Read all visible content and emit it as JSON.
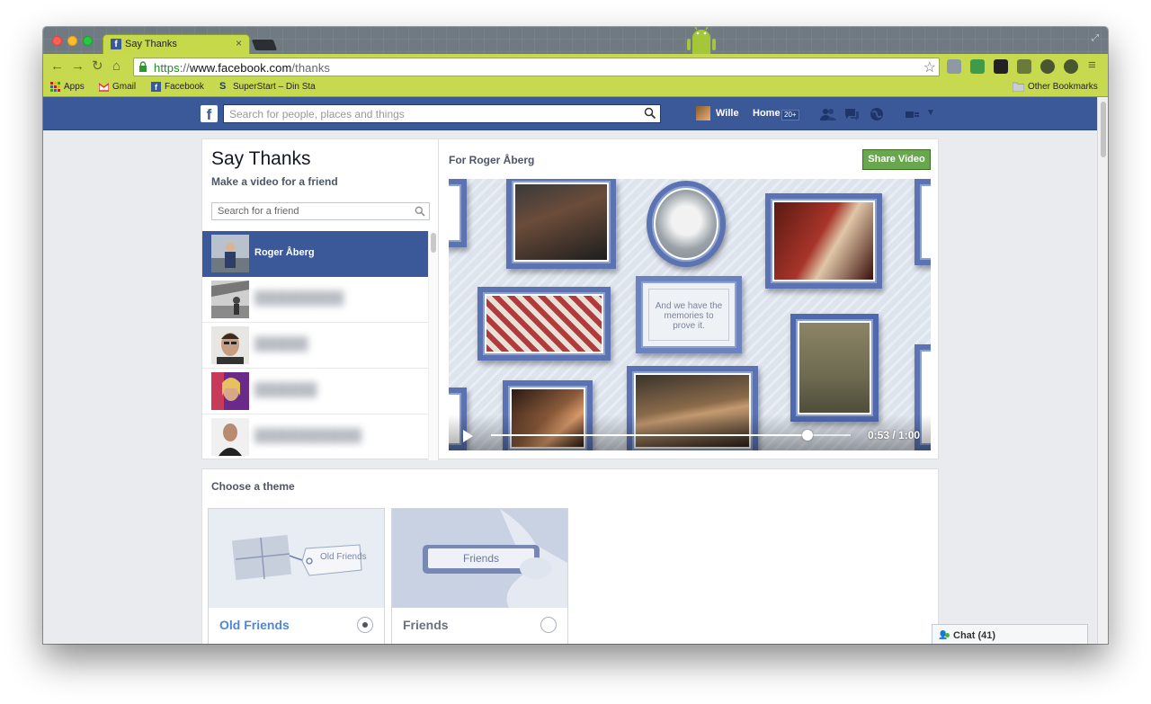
{
  "browser": {
    "tab_title": "Say Thanks",
    "tab_close": "×",
    "url_scheme": "https",
    "url_sep": "://",
    "url_host": "www.facebook.com",
    "url_path": "/thanks",
    "bookmarks": [
      {
        "label": "Apps",
        "icon": "apps-grid-icon"
      },
      {
        "label": "Gmail",
        "icon": "gmail-icon"
      },
      {
        "label": "Facebook",
        "icon": "facebook-icon"
      },
      {
        "label": "SuperStart – Din Sta",
        "icon": "superstart-icon"
      }
    ],
    "other_bookmarks": "Other Bookmarks"
  },
  "facebook": {
    "search_placeholder": "Search for people, places and things",
    "user_name": "Wille",
    "home_label": "Home",
    "home_count": "20+"
  },
  "say_thanks": {
    "title": "Say Thanks",
    "subtitle": "Make a video for a friend",
    "friend_search_placeholder": "Search for a friend",
    "friends": [
      {
        "name": "Roger Åberg",
        "selected": true
      },
      {
        "name": "",
        "selected": false
      },
      {
        "name": "",
        "selected": false
      },
      {
        "name": "",
        "selected": false
      },
      {
        "name": "",
        "selected": false
      }
    ],
    "for_label": "For Roger Åberg",
    "share_button": "Share Video",
    "video_caption": "And we have the memories to prove it.",
    "video_time": "0:53 / 1:00",
    "video_progress": 0.88
  },
  "themes": {
    "title": "Choose a theme",
    "items": [
      {
        "label": "Old Friends",
        "thumb_text": "Old Friends",
        "selected": true
      },
      {
        "label": "Friends",
        "thumb_text": "Friends",
        "selected": false
      }
    ]
  },
  "chat": {
    "label": "Chat (41)"
  }
}
